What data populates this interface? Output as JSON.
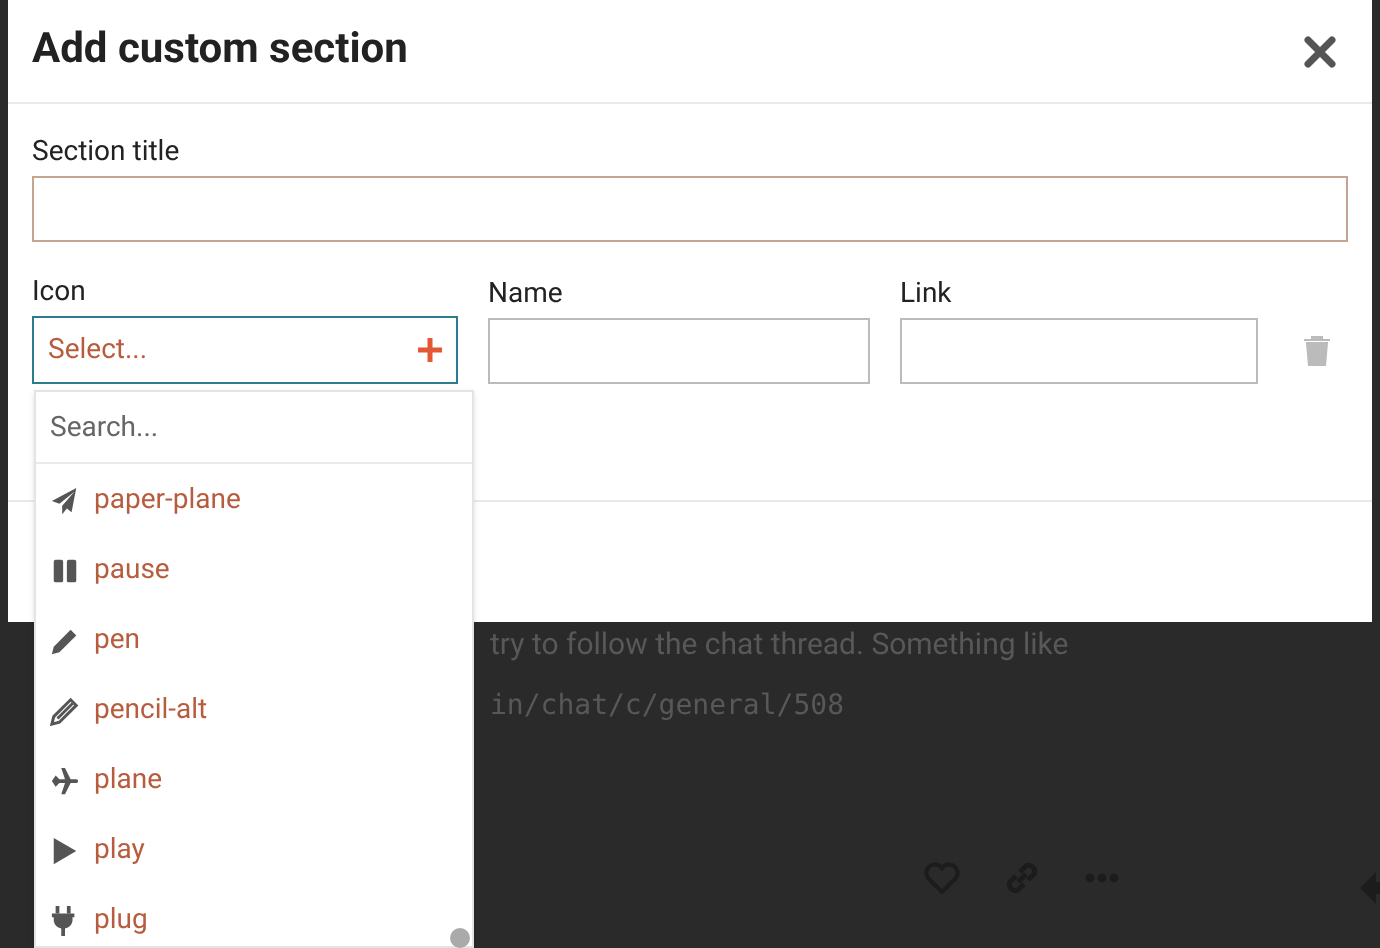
{
  "background": {
    "lines": [
      {
        "kind": "text",
        "text": "try to follow the chat thread. Something like"
      },
      {
        "kind": "code",
        "text": "in/chat/c/general/508"
      }
    ]
  },
  "dialog": {
    "title": "Add custom section",
    "section_title": {
      "label": "Section title"
    },
    "row": {
      "icon": {
        "label": "Icon",
        "value": "Select..."
      },
      "name": {
        "label": "Name"
      },
      "link": {
        "label": "Link"
      }
    }
  },
  "dropdown": {
    "search": {
      "placeholder": "Search..."
    },
    "options": [
      {
        "label": "paper-plane",
        "kind": "paper-plane"
      },
      {
        "label": "pause",
        "kind": "pause"
      },
      {
        "label": "pen",
        "kind": "pen"
      },
      {
        "label": "pencil-alt",
        "kind": "pencil"
      },
      {
        "label": "plane",
        "kind": "plane"
      },
      {
        "label": "play",
        "kind": "play"
      },
      {
        "label": "plug",
        "kind": "plug"
      }
    ]
  }
}
